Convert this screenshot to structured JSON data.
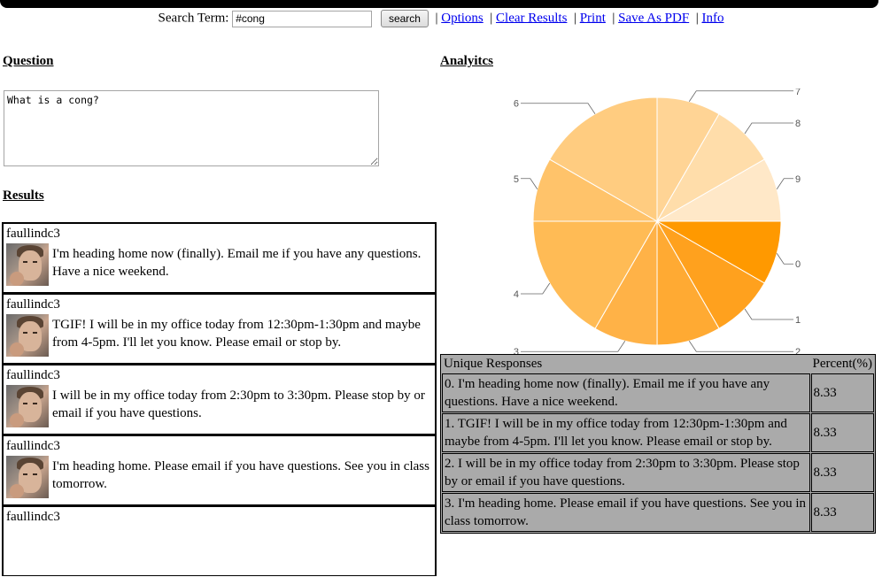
{
  "search": {
    "label": "Search Term:",
    "value": "#cong",
    "button": "search"
  },
  "links": [
    "Options",
    "Clear Results",
    "Print",
    "Save As PDF",
    "Info"
  ],
  "question": {
    "heading": "Question",
    "text": "What is a cong?"
  },
  "results": {
    "heading": "Results",
    "items": [
      {
        "user": "faullindc3",
        "text": "I'm heading home now (finally). Email me if you have any questions. Have a nice weekend."
      },
      {
        "user": "faullindc3",
        "text": "TGIF! I will be in my office today from 12:30pm-1:30pm and maybe from 4-5pm. I'll let you know. Please email or stop by."
      },
      {
        "user": "faullindc3",
        "text": "I will be in my office today from 2:30pm to 3:30pm. Please stop by or email if you have questions."
      },
      {
        "user": "faullindc3",
        "text": "I'm heading home. Please email if you have questions. See you in class tomorrow."
      },
      {
        "user": "faullindc3",
        "text": ""
      }
    ]
  },
  "analytics": {
    "heading": "Analyitcs",
    "table_headers": [
      "Unique Responses",
      "Percent(%)"
    ],
    "rows": [
      {
        "response": "0. I'm heading home now (finally). Email me if you have any questions. Have a nice weekend.",
        "percent": "8.33"
      },
      {
        "response": "1. TGIF! I will be in my office today from 12:30pm-1:30pm and maybe from 4-5pm. I'll let you know. Please email or stop by.",
        "percent": "8.33"
      },
      {
        "response": "2. I will be in my office today from 2:30pm to 3:30pm. Please stop by or email if you have questions.",
        "percent": "8.33"
      },
      {
        "response": "3. I'm heading home. Please email if you have questions. See you in class tomorrow.",
        "percent": "8.33"
      }
    ]
  },
  "chart_data": {
    "type": "pie",
    "labels": [
      "0",
      "1",
      "2",
      "3",
      "4",
      "5",
      "6",
      "7",
      "8",
      "9"
    ],
    "values": [
      8.33,
      8.33,
      8.33,
      8.33,
      16.67,
      8.33,
      16.67,
      8.33,
      8.33,
      8.33
    ],
    "colors": [
      "#ff9900",
      "#ffa11e",
      "#ffaa33",
      "#ffb247",
      "#ffbb55",
      "#ffc36a",
      "#ffcc80",
      "#ffd495",
      "#ffddaa",
      "#ffe8c8"
    ]
  }
}
